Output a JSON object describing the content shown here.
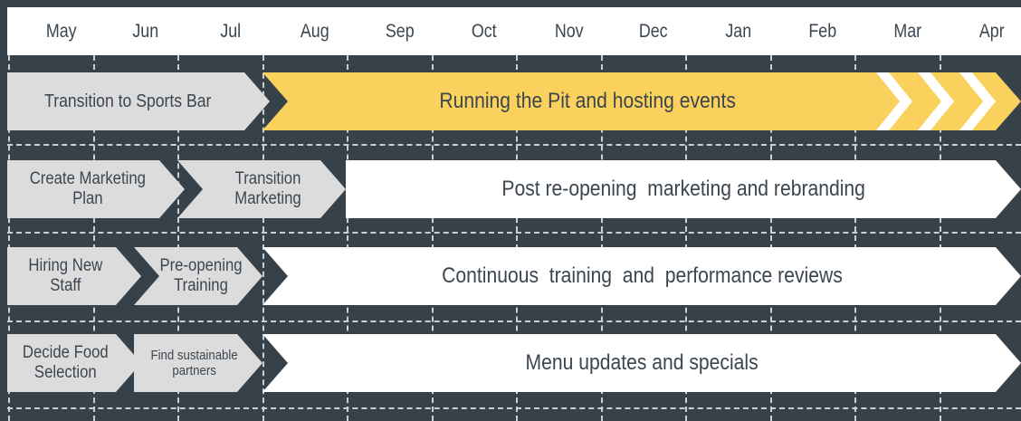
{
  "months": [
    "May",
    "Jun",
    "Jul",
    "Aug",
    "Sep",
    "Oct",
    "Nov",
    "Dec",
    "Jan",
    "Feb",
    "Mar",
    "Apr"
  ],
  "rows": [
    {
      "tasks": [
        {
          "label": "Transition to Sports Bar",
          "style": "grey"
        },
        {
          "label": "Running the Pit and hosting events",
          "style": "yellow"
        }
      ]
    },
    {
      "tasks": [
        {
          "label": "Create Marketing Plan",
          "style": "grey"
        },
        {
          "label": "Transition Marketing",
          "style": "grey"
        },
        {
          "label": "Post re-opening  marketing and rebranding",
          "style": "white"
        }
      ]
    },
    {
      "tasks": [
        {
          "label": "Hiring New Staff",
          "style": "grey"
        },
        {
          "label": "Pre-opening Training",
          "style": "grey"
        },
        {
          "label": "Continuous  training  and  performance reviews",
          "style": "white"
        }
      ]
    },
    {
      "tasks": [
        {
          "label": "Decide Food Selection",
          "style": "grey"
        },
        {
          "label": "Find sustainable partners",
          "style": "grey"
        },
        {
          "label": "Menu updates and specials",
          "style": "white"
        }
      ]
    }
  ],
  "colors": {
    "background": "#37414a",
    "accent": "#f9d15c",
    "grey": "#dcdcdc",
    "white": "#ffffff"
  }
}
